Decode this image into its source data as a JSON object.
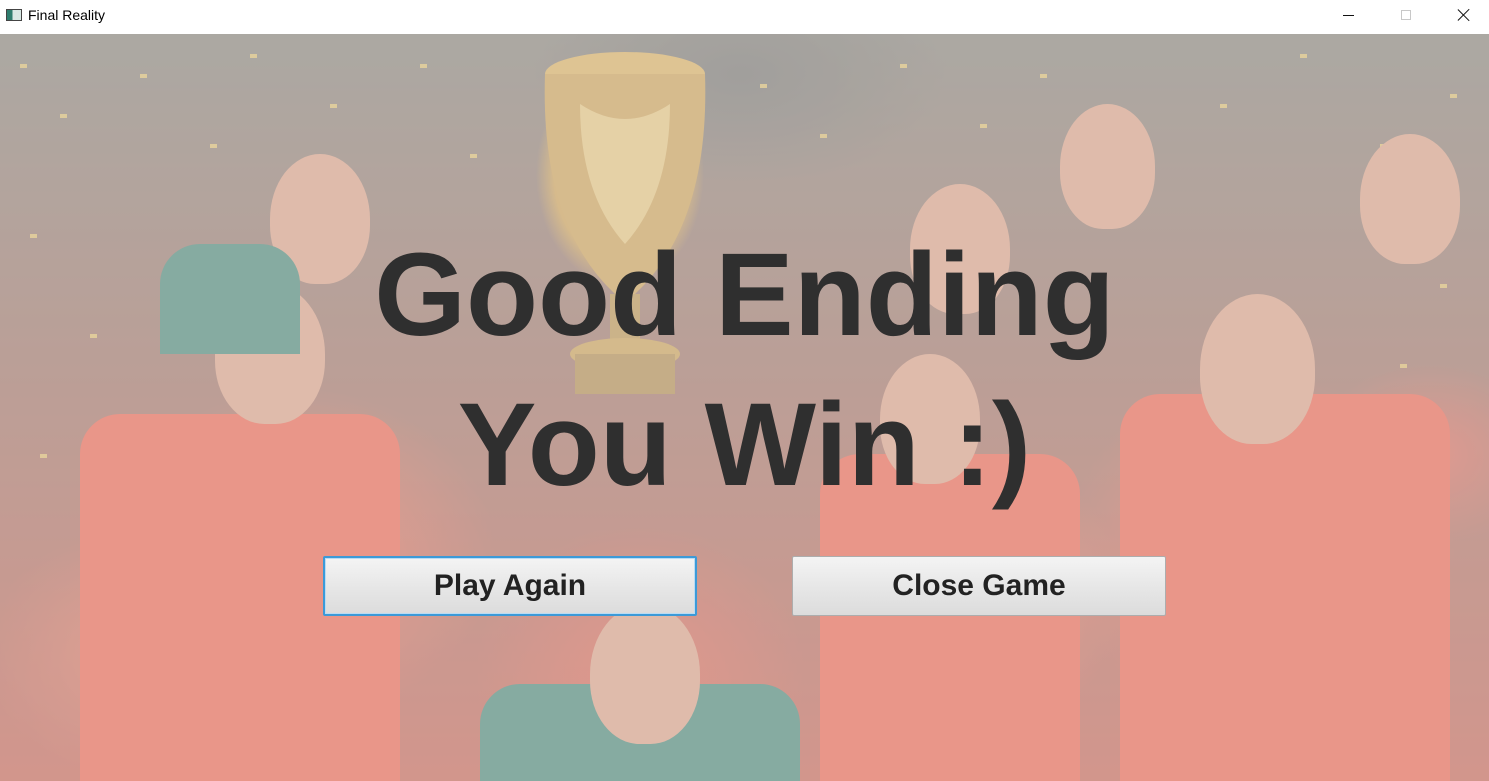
{
  "window": {
    "title": "Final Reality",
    "controls": {
      "minimize": "minimize-icon",
      "maximize": "maximize-icon",
      "close": "close-icon"
    }
  },
  "screen": {
    "headline_line1": "Good Ending",
    "headline_line2": "You Win :)",
    "buttons": {
      "play_again": "Play Again",
      "close_game": "Close Game"
    }
  },
  "colors": {
    "headline_text": "#2f2f2f",
    "focus_border": "#3c9ad8",
    "button_face": "#e6e6e6"
  }
}
